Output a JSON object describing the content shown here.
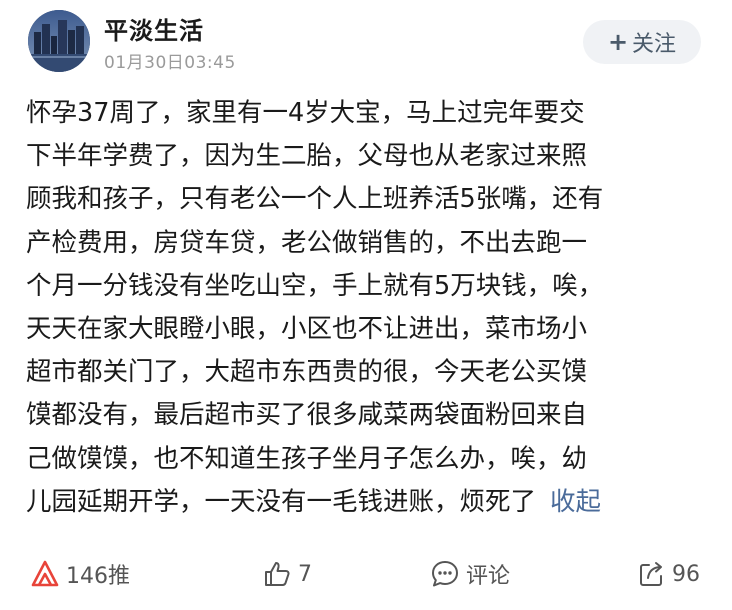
{
  "post": {
    "author_name": "平淡生活",
    "time": "01月30日03:45",
    "follow_label": "关注",
    "body_lines": [
      "怀孕37周了，家里有一4岁大宝，马上过完年要交",
      "下半年学费了，因为生二胎，父母也从老家过来照",
      "顾我和孩子，只有老公一个人上班养活5张嘴，还有",
      "产检费用，房贷车贷，老公做销售的，不出去跑一",
      "个月一分钱没有坐吃山空，手上就有5万块钱，唉，",
      "天天在家大眼瞪小眼，小区也不让进出，菜市场小",
      "超市都关门了，大超市东西贵的很，今天老公买馍",
      "馍都没有，最后超市买了很多咸菜两袋面粉回来自",
      "己做馍馍，也不知道生孩子坐月子怎么办，唉，幼",
      "儿园延期开学，一天没有一毛钱进账，烦死了"
    ],
    "collapse_label": "收起"
  },
  "footer": {
    "recommend_label": "146推",
    "like_count": "7",
    "comment_label": "评论",
    "share_count": "96"
  },
  "icons": {
    "recommend": "recommend-icon",
    "like": "thumbs-up-icon",
    "comment": "comment-icon",
    "share": "share-icon"
  },
  "colors": {
    "collapse_link": "#4a6b9a",
    "recommend_icon": "#e8443a",
    "follow_bg": "#f0f2f5",
    "meta_gray": "#9a9a9a"
  }
}
